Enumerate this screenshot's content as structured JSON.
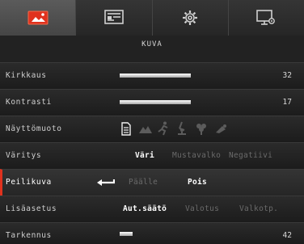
{
  "tabs": [
    {
      "name": "picture-tab",
      "icon": "picture-icon",
      "active": true
    },
    {
      "name": "display-tab",
      "icon": "display-settings-icon",
      "active": false
    },
    {
      "name": "settings-tab",
      "icon": "gear-icon",
      "active": false
    },
    {
      "name": "system-tab",
      "icon": "monitor-settings-icon",
      "active": false
    }
  ],
  "heading": "KUVA",
  "accent_color": "#e0321e",
  "rows": {
    "kirkkaus": {
      "label": "Kirkkaus",
      "value": "32",
      "level": 1.0
    },
    "kontrasti": {
      "label": "Kontrasti",
      "value": "17",
      "level": 1.0
    },
    "nayttomuoto": {
      "label": "Näyttömuoto",
      "icons": [
        "document-icon",
        "mountain-icon",
        "sport-icon",
        "science-icon",
        "nature-icon",
        "microscope-icon"
      ],
      "selected_icon": "document-icon"
    },
    "varitys": {
      "label": "Väritys",
      "options": [
        "Väri",
        "Mustavalko",
        "Negatiivi"
      ],
      "selected": "Väri"
    },
    "peilikuva": {
      "label": "Peilikuva",
      "icon": "return-arrow-icon",
      "options": [
        "Päälle",
        "Pois"
      ],
      "selected": "Pois"
    },
    "lisaasetus": {
      "label": "Lisäasetus",
      "options": [
        "Aut.säätö",
        "Valotus",
        "Valkotp."
      ],
      "selected": "Aut.säätö"
    },
    "tarkennus": {
      "label": "Tarkennus",
      "value": "42",
      "level": 0.18
    }
  }
}
